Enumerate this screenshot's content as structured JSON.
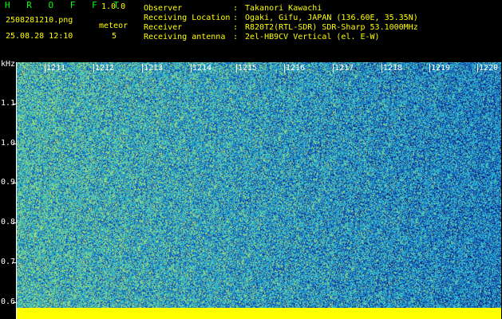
{
  "header": {
    "app_title": "H R O F F T",
    "app_version": "1.0.0",
    "file_name": "2508281210.png",
    "timestamp": "25.08.28 12:10",
    "mode_label": "meteor",
    "count_value": "5"
  },
  "info": [
    {
      "label": "Observer",
      "sep": ":",
      "value": "Takanori Kawachi"
    },
    {
      "label": "Receiving Location",
      "sep": ":",
      "value": "Ogaki, Gifu, JAPAN (136.60E, 35.35N)"
    },
    {
      "label": "Receiver",
      "sep": ":",
      "value": "R820T2(RTL-SDR) SDR-Sharp 53.1000MHz"
    },
    {
      "label": "Receiving antenna",
      "sep": ":",
      "value": "2el-HB9CV Vertical (el. E-W)"
    }
  ],
  "y_axis": {
    "unit": "kHz",
    "ticks": [
      "1.1",
      "1.0",
      "0.9",
      "0.8",
      "0.7",
      "0.6"
    ]
  },
  "x_axis": {
    "ticks": [
      "1211",
      "1212",
      "1213",
      "1214",
      "1215",
      "1216",
      "1217",
      "1218",
      "1219",
      "1220"
    ]
  },
  "colors": {
    "background": "#000000",
    "header_green": "#00ff00",
    "header_yellow": "#ffff00",
    "axis_white": "#ffffff",
    "noise_floor": "#ffff00",
    "spectrogram_low": "#0a1a8a",
    "spectrogram_mid": "#1d9fd8",
    "spectrogram_high": "#5cd6a0"
  }
}
